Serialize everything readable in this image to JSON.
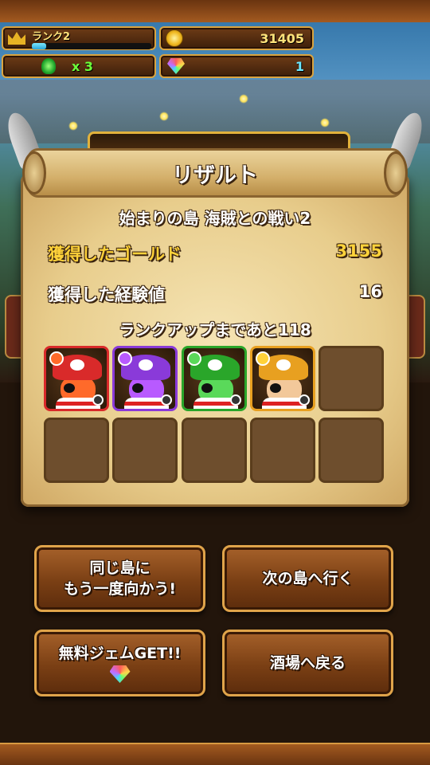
{
  "hud": {
    "rank_label": "ランク2",
    "rank_progress": 0.12,
    "gold": "31405",
    "potion_count": "x 3",
    "gems": "1"
  },
  "result": {
    "title": "リザルト",
    "stage_name": "始まりの島 海賊との戦い2",
    "gold_label": "獲得したゴールド",
    "gold_value": "3155",
    "exp_label": "獲得した経験値",
    "exp_value": "16",
    "rankup_text": "ランクアップまであと118",
    "characters": [
      {
        "icon": "red-pirate-icon",
        "color": "#d92a2a",
        "element": "#ff6a2a"
      },
      {
        "icon": "purple-pirate-icon",
        "color": "#8a3ad9",
        "element": "#b85aff"
      },
      {
        "icon": "green-pirate-icon",
        "color": "#2aa62a",
        "element": "#5ad95a"
      },
      {
        "icon": "yellow-pirate-icon",
        "color": "#e8a020",
        "element": "#ffd23a"
      }
    ]
  },
  "buttons": {
    "retry": "同じ島に\nもう一度向かう!",
    "next_island": "次の島へ行く",
    "free_gems": "無料ジェムGET!!",
    "tavern": "酒場へ戻る"
  },
  "colors": {
    "accent_gold": "#ffd23a",
    "panel": "#e8cd8c",
    "button_border": "#e0a44a"
  }
}
